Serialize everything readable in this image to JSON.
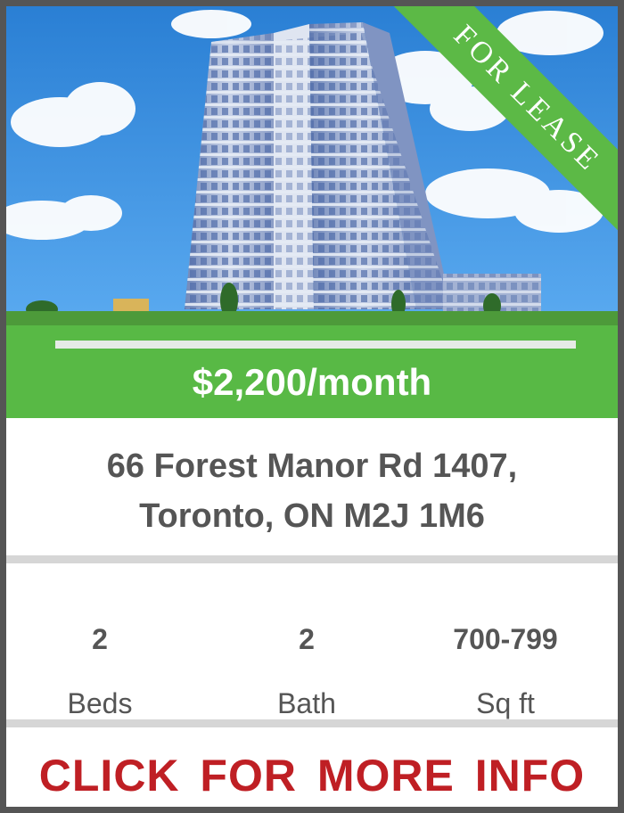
{
  "listing": {
    "ribbon_label": "FOR LEASE",
    "price": "$2,200/month",
    "address_line1": "66 Forest Manor Rd 1407,",
    "address_line2": "Toronto, ON M2J 1M6",
    "stats": [
      {
        "value": "2",
        "label": "Beds"
      },
      {
        "value": "2",
        "label": "Bath"
      },
      {
        "value": "700-799",
        "label": "Sq ft"
      }
    ],
    "cta_label": "CLICK FOR MORE INFO"
  },
  "colors": {
    "accent_green": "#5cb946",
    "cta_red": "#bf1f24",
    "text_gray": "#555555",
    "border": "#555555"
  }
}
